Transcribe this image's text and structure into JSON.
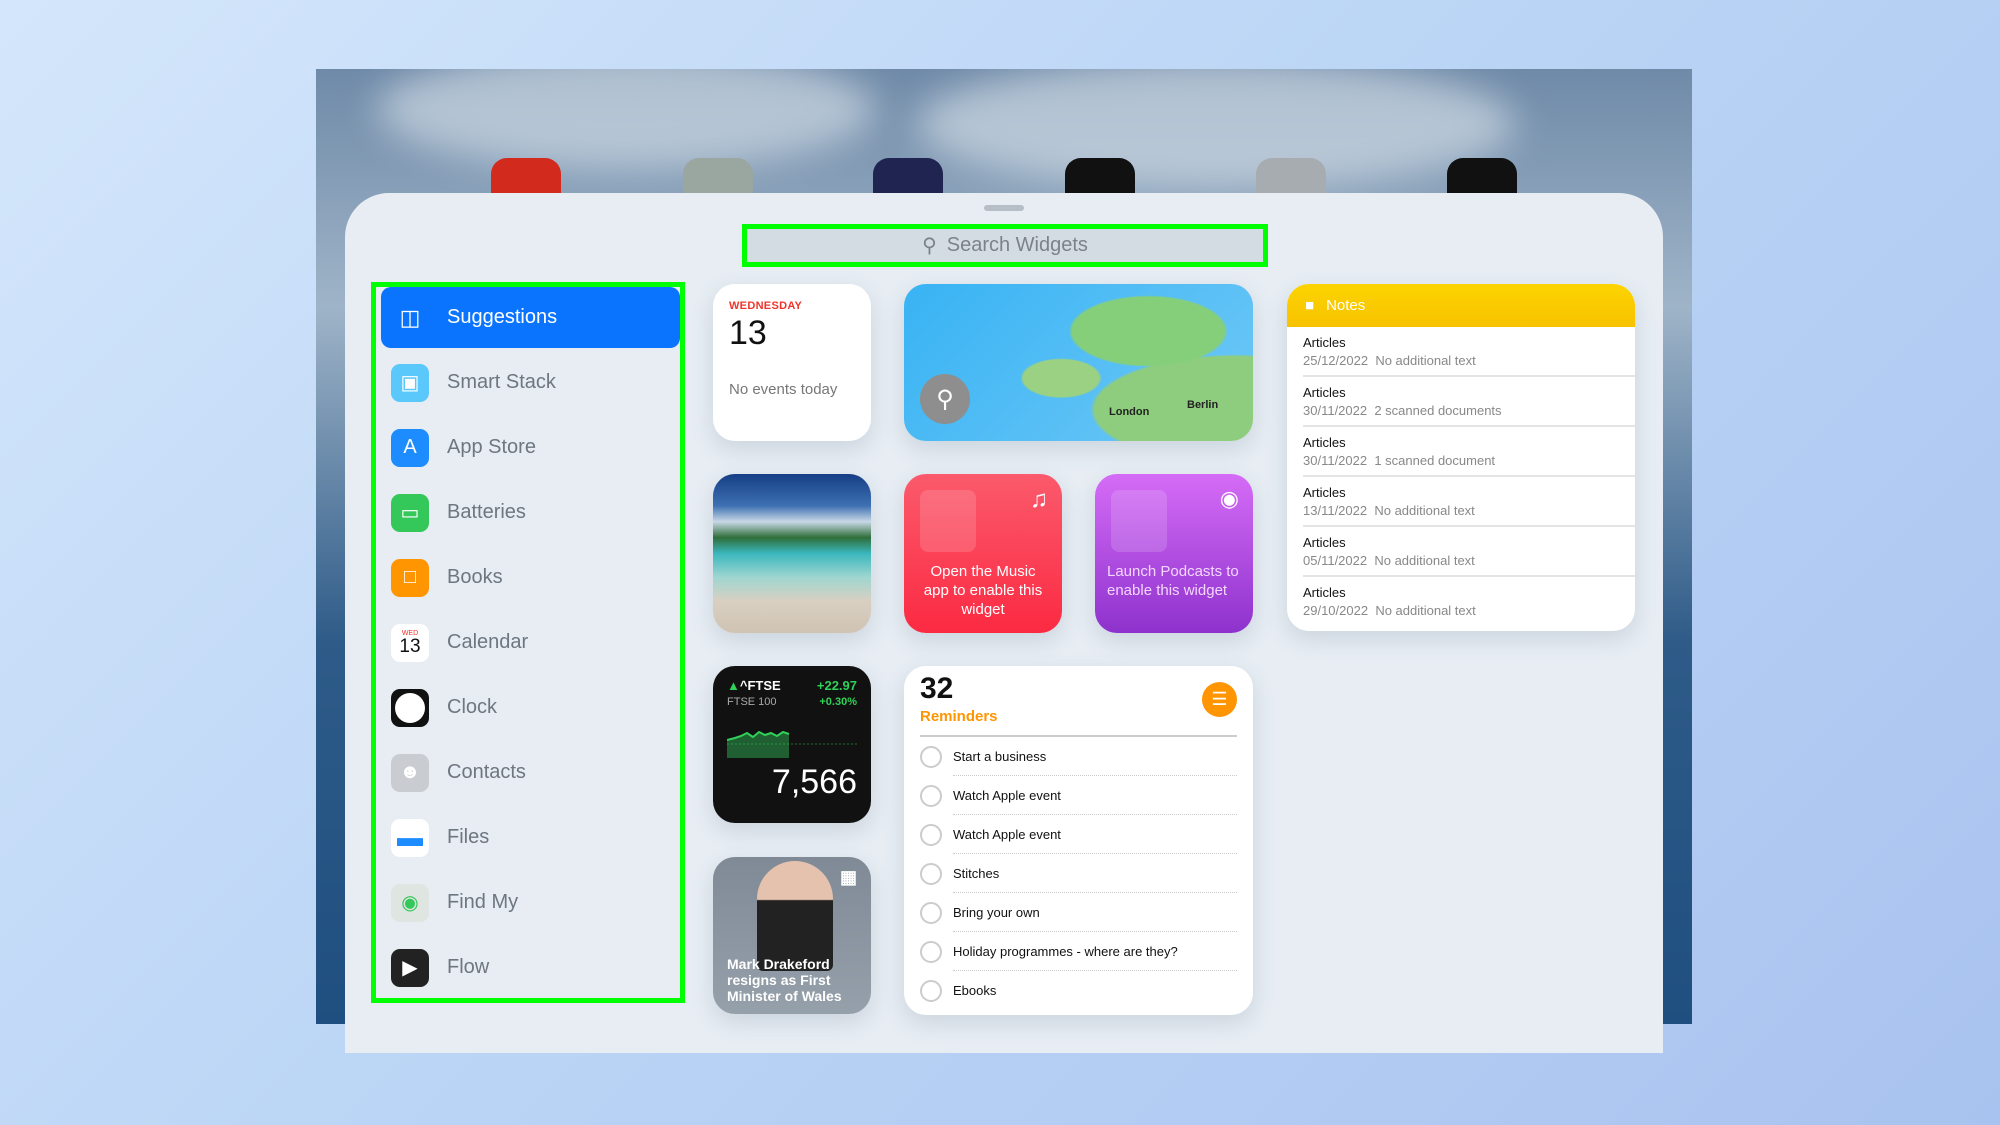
{
  "search": {
    "placeholder": "Search Widgets"
  },
  "sidebar": {
    "items": [
      {
        "label": "Suggestions",
        "icon": "suggestions-icon",
        "color": "#0a74ff"
      },
      {
        "label": "Smart Stack",
        "icon": "smart-stack-icon",
        "color": "#5ac8fa"
      },
      {
        "label": "App Store",
        "icon": "app-store-icon",
        "color": "#1c8cff"
      },
      {
        "label": "Batteries",
        "icon": "battery-icon",
        "color": "#34c759"
      },
      {
        "label": "Books",
        "icon": "book-icon",
        "color": "#ff9500"
      },
      {
        "label": "Calendar",
        "icon": "calendar-icon",
        "color": "#ffffff",
        "day": "WED",
        "date": "13"
      },
      {
        "label": "Clock",
        "icon": "clock-icon",
        "color": "#111111"
      },
      {
        "label": "Contacts",
        "icon": "contacts-icon",
        "color": "#c9ccd0"
      },
      {
        "label": "Files",
        "icon": "folder-icon",
        "color": "#ffffff"
      },
      {
        "label": "Find My",
        "icon": "find-my-icon",
        "color": "#34c759"
      },
      {
        "label": "Flow",
        "icon": "flow-icon",
        "color": "#222222"
      }
    ]
  },
  "calendar_widget": {
    "weekday": "WEDNESDAY",
    "date": "13",
    "events": "No events today"
  },
  "map_widget": {
    "labels": [
      "London",
      "Berlin"
    ]
  },
  "notes_widget": {
    "title": "Notes",
    "items": [
      {
        "title": "Articles",
        "date": "25/12/2022",
        "detail": "No additional text"
      },
      {
        "title": "Articles",
        "date": "30/11/2022",
        "detail": "2 scanned documents"
      },
      {
        "title": "Articles",
        "date": "30/11/2022",
        "detail": "1 scanned document"
      },
      {
        "title": "Articles",
        "date": "13/11/2022",
        "detail": "No additional text"
      },
      {
        "title": "Articles",
        "date": "05/11/2022",
        "detail": "No additional text"
      },
      {
        "title": "Articles",
        "date": "29/10/2022",
        "detail": "No additional text"
      }
    ]
  },
  "music_widget": {
    "text": "Open the Music app to enable this widget"
  },
  "podcasts_widget": {
    "text": "Launch Podcasts to enable this widget"
  },
  "stocks_widget": {
    "symbol": "^FTSE",
    "name": "FTSE 100",
    "change": "+22.97",
    "percent": "+0.30%",
    "price": "7,566",
    "accent": "#30d158"
  },
  "reminders_widget": {
    "count": "32",
    "title": "Reminders",
    "accent": "#ff9500",
    "items": [
      "Start a business",
      "Watch Apple event",
      "Watch Apple event",
      "Stitches",
      "Bring your own",
      "Holiday programmes - where are they?",
      "Ebooks"
    ]
  },
  "news_widget": {
    "headline": "Mark Drakeford resigns as First Minister of Wales"
  }
}
